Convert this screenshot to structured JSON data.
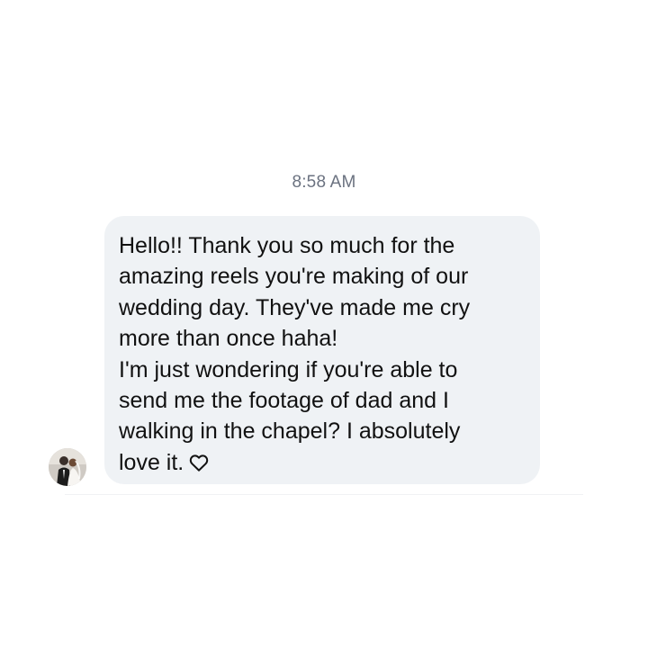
{
  "conversation": {
    "timestamp": "8:58 AM",
    "message": {
      "sender_avatar_icon": "wedding-couple-photo-avatar",
      "lines": [
        "Hello!! Thank you so much for the",
        "amazing reels you're making of our",
        "wedding day. They've made me cry",
        "more than once haha!",
        "I'm just wondering if you're able to",
        "send me the footage of dad and I",
        "walking in the chapel? I absolutely",
        "love it."
      ],
      "trailing_icon": "heart-outline-icon",
      "bubble_color": "#eff2f5",
      "text_color": "#111111"
    }
  }
}
